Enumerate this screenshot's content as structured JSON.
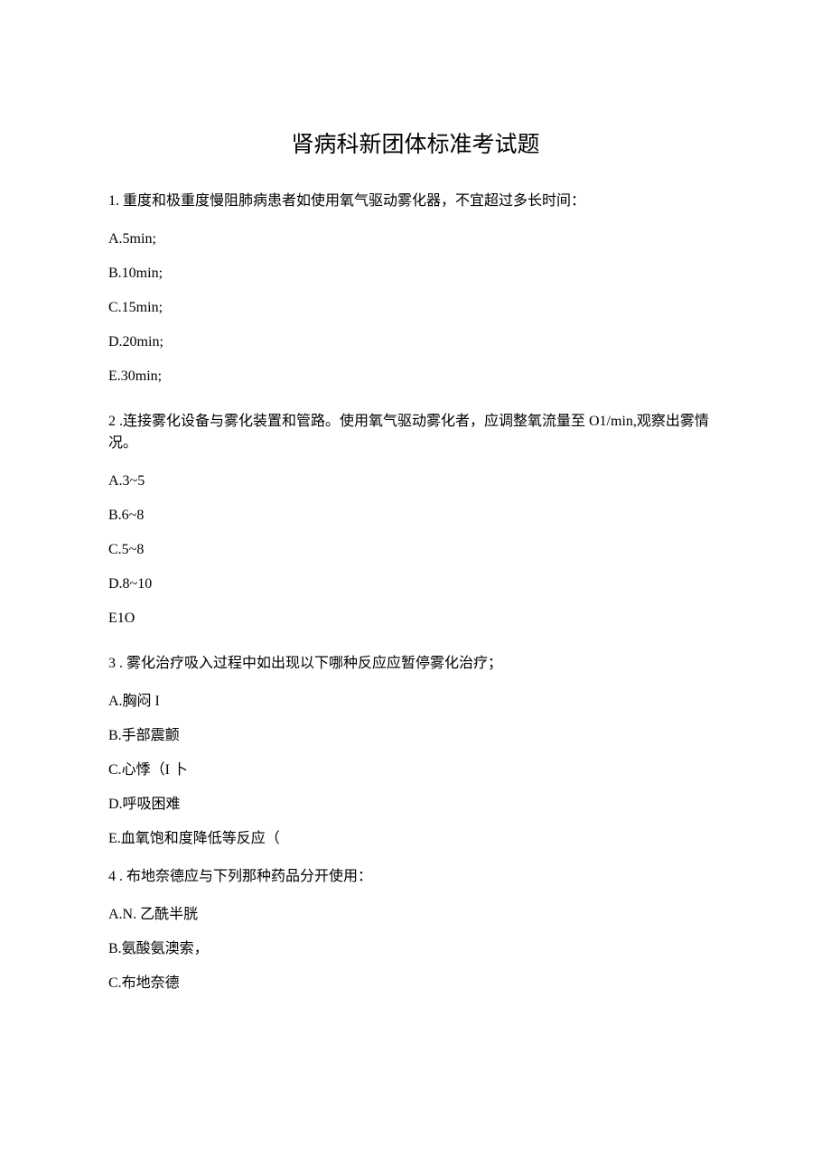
{
  "title": "肾病科新团体标准考试题",
  "questions": [
    {
      "stem": "1. 重度和极重度慢阻肺病患者如使用氧气驱动雾化器，不宜超过多长时间：",
      "options": [
        "A.5min;",
        "B.10min;",
        "C.15min;",
        "D.20min;",
        "E.30min;"
      ]
    },
    {
      "stem": "2  .连接雾化设备与雾化装置和管路。使用氧气驱动雾化者，应调整氧流量至 O1/min,观察出雾情况。",
      "options": [
        "A.3~5",
        "B.6~8",
        "C.5~8",
        "D.8~10",
        "E1O"
      ]
    },
    {
      "stem": "3  . 雾化治疗吸入过程中如出现以下哪种反应应暂停雾化治疗；",
      "options": [
        "A.胸闷 I",
        "B.手部震颤",
        "C.心悸（I 卜",
        "D.呼吸困难",
        "E.血氧饱和度降低等反应（"
      ]
    },
    {
      "stem": "4  . 布地奈德应与下列那种药品分开使用：",
      "options": [
        "A.N. 乙酰半胱",
        "B.氨酸氨澳索，",
        "C.布地奈德"
      ]
    }
  ]
}
